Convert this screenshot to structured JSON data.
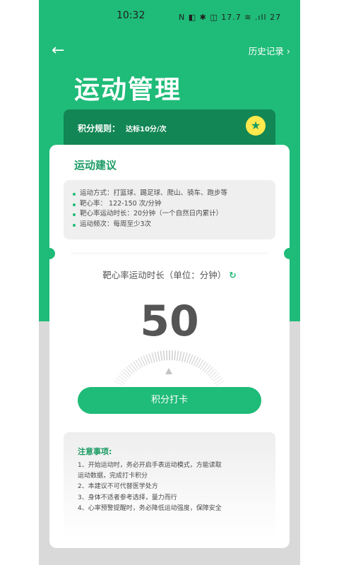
{
  "status_bar": {
    "time": "10:32",
    "icons_text": "N ◧ ✱ ◫ 17.7 ≋ .ıll 27"
  },
  "header": {
    "back_icon": "arrow-left-icon",
    "history_label": "历史记录",
    "title": "运动管理"
  },
  "rule": {
    "label": "积分规则：",
    "value": "达标10分/次",
    "icon": "star-icon"
  },
  "advice": {
    "title": "运动建议",
    "items": [
      "运动方式：打篮球、踢足球、爬山、骑车、跑步等",
      "靶心率：  122-150 次/分钟",
      "靶心率运动时长：20分钟（一个自然日内累计）",
      "运动频次：每周至少3次"
    ]
  },
  "heart_rate": {
    "label": "靶心率运动时长（单位：分钟）",
    "refresh_icon": "refresh-icon",
    "value": "50"
  },
  "checkin_button": "积分打卡",
  "notice": {
    "title": "注意事项:",
    "lines": [
      "1、开始运动时，务必开启手表运动模式，方能读取",
      "运动数据，完成打卡积分",
      "2、本建议不可代替医学处方",
      "3、身体不适者参考选择，量力而行",
      "4、心率预警提醒时，务必降低运动强度，保障安全"
    ]
  },
  "colors": {
    "primary": "#1fbb78",
    "dark_green": "#128654",
    "star_bg": "#ffe94d"
  }
}
